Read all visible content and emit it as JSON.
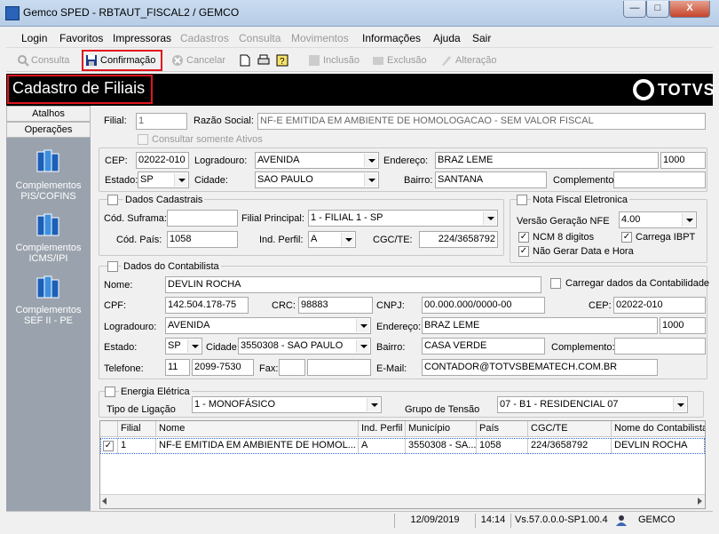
{
  "window": {
    "title": "Gemco SPED - RBTAUT_FISCAL2 / GEMCO",
    "min": "—",
    "max": "□",
    "close": "X"
  },
  "menu": [
    "Login",
    "Favoritos",
    "Impressoras",
    "Cadastros",
    "Consulta",
    "Movimentos",
    "Informações",
    "Ajuda",
    "Sair"
  ],
  "toolbar": {
    "consulta": "Consulta",
    "confirmacao": "Confirmação",
    "cancelar": "Cancelar",
    "inclusao": "Inclusão",
    "exclusao": "Exclusão",
    "alteracao": "Alteração"
  },
  "header": {
    "title": "Cadastro de Filiais",
    "logo": "TOTVS"
  },
  "sidebar": {
    "tabs": [
      "Atalhos",
      "Operações"
    ],
    "items": [
      [
        "Complementos",
        "PIS/COFINS"
      ],
      [
        "Complementos",
        "ICMS/IPI"
      ],
      [
        "Complementos",
        "SEF II - PE"
      ]
    ]
  },
  "filial": {
    "filial_label": "Filial:",
    "filial": "1",
    "razao_label": "Razão Social:",
    "razao": "NF-E EMITIDA EM AMBIENTE DE HOMOLOGACAO - SEM VALOR FISCAL",
    "consultar_ativos": "Consultar somente Ativos"
  },
  "endereco": {
    "cep_label": "CEP:",
    "cep": "02022-010",
    "logradouro_label": "Logradouro:",
    "logradouro": "AVENIDA",
    "endereco_label": "Endereço:",
    "endereco": "BRAZ LEME",
    "numero": "1000",
    "estado_label": "Estado:",
    "estado": "SP",
    "cidade_label": "Cidade:",
    "cidade": "SAO PAULO",
    "bairro_label": "Bairro:",
    "bairro": "SANTANA",
    "complemento_label": "Complemento",
    "complemento": ""
  },
  "dados_cadastrais": {
    "title": "Dados Cadastrais",
    "suframa_label": "Cód. Suframa:",
    "suframa": "",
    "filial_principal_label": "Filial Principal:",
    "filial_principal": "1 - FILIAL 1 - SP",
    "pais_label": "Cód. País:",
    "pais": "1058",
    "ind_perfil_label": "Ind. Perfil:",
    "ind_perfil": "A",
    "cgc_label": "CGC/TE:",
    "cgc": "224/3658792"
  },
  "nfe": {
    "title": "Nota Fiscal Eletronica",
    "versao_label": "Versão Geração NFE",
    "versao": "4.00",
    "ncm": "NCM 8 digitos",
    "ibpt": "Carrega IBPT",
    "nao_gerar": "Não Gerar Data e Hora"
  },
  "contabilista": {
    "title": "Dados do Contabilista",
    "nome_label": "Nome:",
    "nome": "DEVLIN ROCHA",
    "carregar": "Carregar dados da Contabilidade",
    "cpf_label": "CPF:",
    "cpf": "142.504.178-75",
    "crc_label": "CRC:",
    "crc": "98883",
    "cnpj_label": "CNPJ:",
    "cnpj": "00.000.000/0000-00",
    "cep_label": "CEP:",
    "cep": "02022-010",
    "logradouro_label": "Logradouro:",
    "logradouro": "AVENIDA",
    "endereco_label": "Endereço:",
    "endereco": "BRAZ LEME",
    "numero": "1000",
    "estado_label": "Estado:",
    "estado": "SP",
    "cidade_label": "Cidade:",
    "cidade": "3550308 - SAO PAULO",
    "bairro_label": "Bairro:",
    "bairro": "CASA VERDE",
    "complemento_label": "Complemento:",
    "complemento": "",
    "telefone_label": "Telefone:",
    "ddd": "11",
    "telefone": "2099-7530",
    "fax_label": "Fax:",
    "fax_ddd": "",
    "fax": "",
    "email_label": "E-Mail:",
    "email": "CONTADOR@TOTVSBEMATECH.COM.BR"
  },
  "energia": {
    "title": "Energia Elétrica",
    "tipo_label": "Tipo de Ligação",
    "tipo": "1 - MONOFÁSICO",
    "grupo_label": "Grupo de Tensão",
    "grupo": "07 - B1 - RESIDENCIAL 07"
  },
  "grid": {
    "columns": [
      "Filial",
      "Nome",
      "Ind. Perfil",
      "Município",
      "País",
      "CGC/TE",
      "Nome do Contabilista"
    ],
    "rows": [
      [
        "1",
        "NF-E EMITIDA EM AMBIENTE DE HOMOL...",
        "A",
        "3550308 - SA...",
        "1058",
        "224/3658792",
        "DEVLIN ROCHA"
      ]
    ]
  },
  "status": {
    "date": "12/09/2019",
    "time": "14:14",
    "version": "Vs.57.0.0.0-SP1.00.4",
    "user": "GEMCO"
  }
}
